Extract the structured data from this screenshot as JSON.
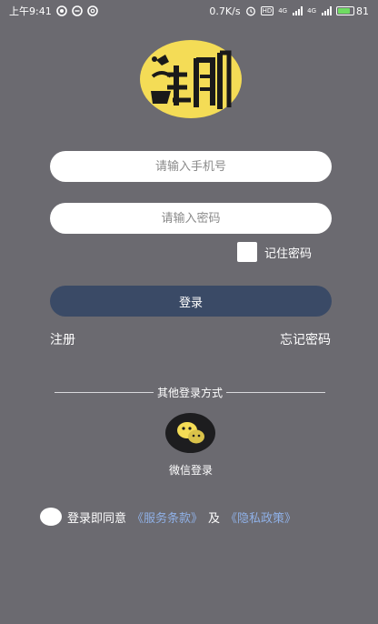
{
  "status_bar": {
    "time": "上午9:41",
    "network_speed": "0.7K/s",
    "battery": "81",
    "battery_level": 81,
    "net_label_1": "HD",
    "net_label_2": "4G",
    "net_label_3": "4G"
  },
  "logo": {
    "icon": "cartoon-character-logo"
  },
  "form": {
    "phone_placeholder": "请输入手机号",
    "password_placeholder": "请输入密码",
    "remember_label": "记住密码",
    "login_label": "登录"
  },
  "links": {
    "register": "注册",
    "forgot": "忘记密码"
  },
  "other_login": {
    "heading": "其他登录方式",
    "wechat_label": "微信登录",
    "wechat_icon": "wechat-icon"
  },
  "agreement": {
    "prefix": "登录即同意",
    "terms": "《服务条款》",
    "and": "及",
    "privacy": "《隐私政策》"
  },
  "colors": {
    "background": "#6b6a70",
    "button": "#3a4a66",
    "link": "#8fb0e6",
    "logo_yellow": "#f4dc56"
  }
}
